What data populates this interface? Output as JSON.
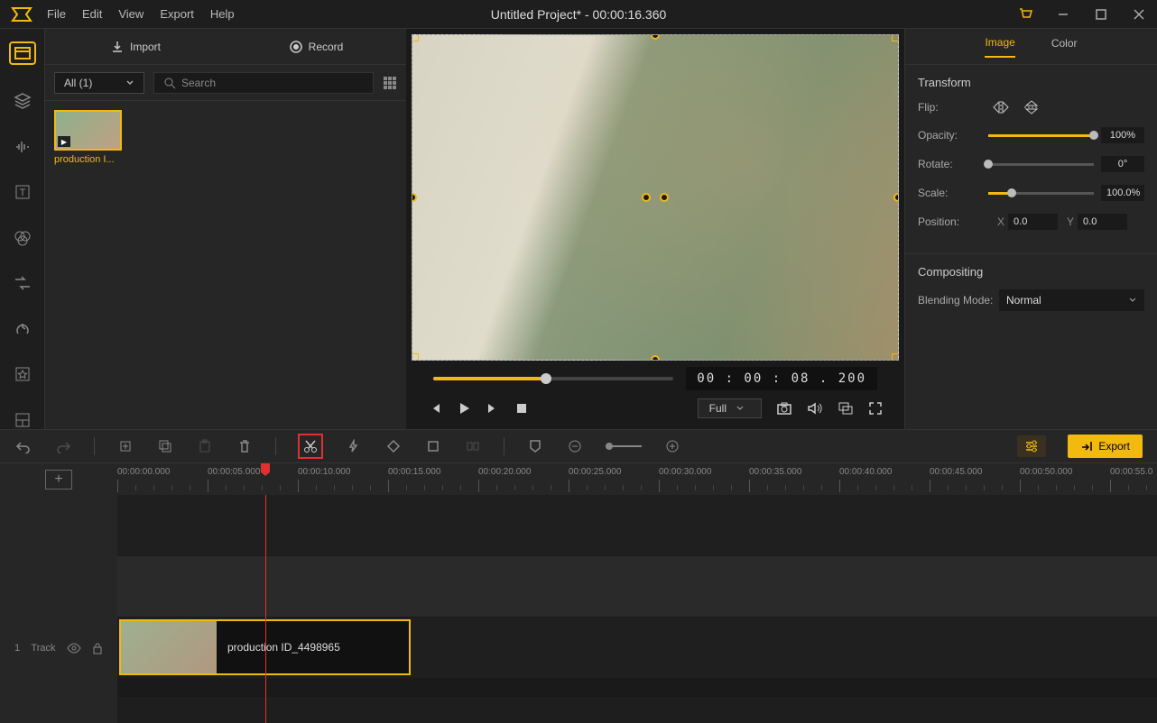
{
  "title": "Untitled Project* - 00:00:16.360",
  "menu": {
    "file": "File",
    "edit": "Edit",
    "view": "View",
    "export": "Export",
    "help": "Help"
  },
  "import": {
    "import_label": "Import",
    "record_label": "Record"
  },
  "filter": {
    "dropdown": "All (1)",
    "search_placeholder": "Search"
  },
  "media": {
    "item_label": "production I..."
  },
  "preview": {
    "timecode": "00 : 00 : 08 . 200",
    "full_label": "Full"
  },
  "props": {
    "tab_image": "Image",
    "tab_color": "Color",
    "transform_title": "Transform",
    "flip_label": "Flip:",
    "opacity_label": "Opacity:",
    "opacity_value": "100%",
    "rotate_label": "Rotate:",
    "rotate_value": "0°",
    "scale_label": "Scale:",
    "scale_value": "100.0%",
    "position_label": "Position:",
    "pos_x_label": "X",
    "pos_x": "0.0",
    "pos_y_label": "Y",
    "pos_y": "0.0",
    "compositing_title": "Compositing",
    "blend_label": "Blending Mode:",
    "blend_value": "Normal"
  },
  "toolbar": {
    "export_label": "Export"
  },
  "ruler": [
    "00:00:00.000",
    "00:00:05.000",
    "00:00:10.000",
    "00:00:15.000",
    "00:00:20.000",
    "00:00:25.000",
    "00:00:30.000",
    "00:00:35.000",
    "00:00:40.000",
    "00:00:45.000",
    "00:00:50.000",
    "00:00:55.0"
  ],
  "track": {
    "num": "1",
    "name": "Track",
    "clip_label": "production ID_4498965"
  }
}
